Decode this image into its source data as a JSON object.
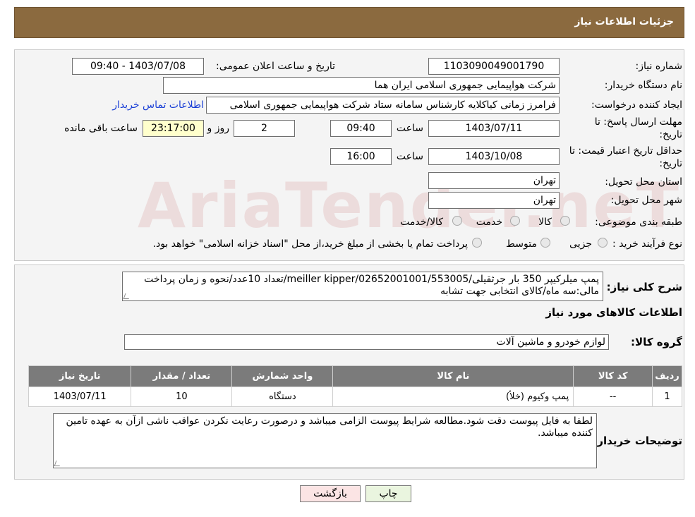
{
  "header": {
    "title": "جزئیات اطلاعات نیاز"
  },
  "form": {
    "need_number_label": "شماره نیاز:",
    "need_number": "1103090049001790",
    "announce_label": "تاریخ و ساعت اعلان عمومی:",
    "announce_value": "1403/07/08 - 09:40",
    "buyer_org_label": "نام دستگاه خریدار:",
    "buyer_org": "شرکت هواپیمایی جمهوری اسلامی ایران هما",
    "creator_label": "ایجاد کننده درخواست:",
    "creator": "فرامرز زمانی کیاکلایه کارشناس سامانه ستاد شرکت هواپیمایی جمهوری اسلامی",
    "contact_link": "اطلاعات تماس خریدار",
    "deadline_label_1": "مهلت ارسال پاسخ: تا",
    "deadline_label_2": "تاریخ:",
    "deadline_date": "1403/07/11",
    "time_label": "ساعت",
    "deadline_time": "09:40",
    "days_value": "2",
    "days_label": "روز و",
    "remaining_time": "23:17:00",
    "remaining_label": "ساعت باقی مانده",
    "validity_label_1": "حداقل تاریخ اعتبار قیمت: تا",
    "validity_label_2": "تاریخ:",
    "validity_date": "1403/10/08",
    "validity_time": "16:00",
    "province_label": "استان محل تحویل:",
    "province": "تهران",
    "city_label": "شهر محل تحویل:",
    "city": "تهران",
    "category_label": "طبقه بندی موضوعی:",
    "category_options": [
      "کالا",
      "خدمت",
      "کالا/خدمت"
    ],
    "process_label": "نوع فرآیند خرید :",
    "process_options": [
      "جزیی",
      "متوسط"
    ],
    "process_note": "پرداخت تمام یا بخشی از مبلغ خرید،از محل \"اسناد خزانه اسلامی\" خواهد بود."
  },
  "details": {
    "description_label": "شرح کلی نیاز:",
    "description": "پمپ میلرکیپر 350 بار جرثقیلی/meiller kipper/02652001001/553005/تعداد 10عدد/نحوه و زمان پرداخت مالی:سه ماه/کالای انتخابی جهت تشابه",
    "goods_info_title": "اطلاعات کالاهای مورد نیاز",
    "goods_group_label": "گروه کالا:",
    "goods_group": "لوازم خودرو و ماشین آلات",
    "table": {
      "headers": [
        "ردیف",
        "کد کالا",
        "نام کالا",
        "واحد شمارش",
        "تعداد / مقدار",
        "تاریخ نیاز"
      ],
      "rows": [
        [
          "1",
          "--",
          "پمپ وکیوم (خلأ)",
          "دستگاه",
          "10",
          "1403/07/11"
        ]
      ]
    },
    "buyer_notes_label": "توضیحات خریدار:",
    "buyer_notes": "لطفا به فایل پیوست دقت شود.مطالعه شرایط پیوست الزامی میباشد و درصورت رعایت نکردن عواقب ناشی ازآن به عهده تامین کننده میباشد."
  },
  "buttons": {
    "print": "چاپ",
    "back": "بازگشت"
  },
  "watermark": "AriaTender.neT"
}
